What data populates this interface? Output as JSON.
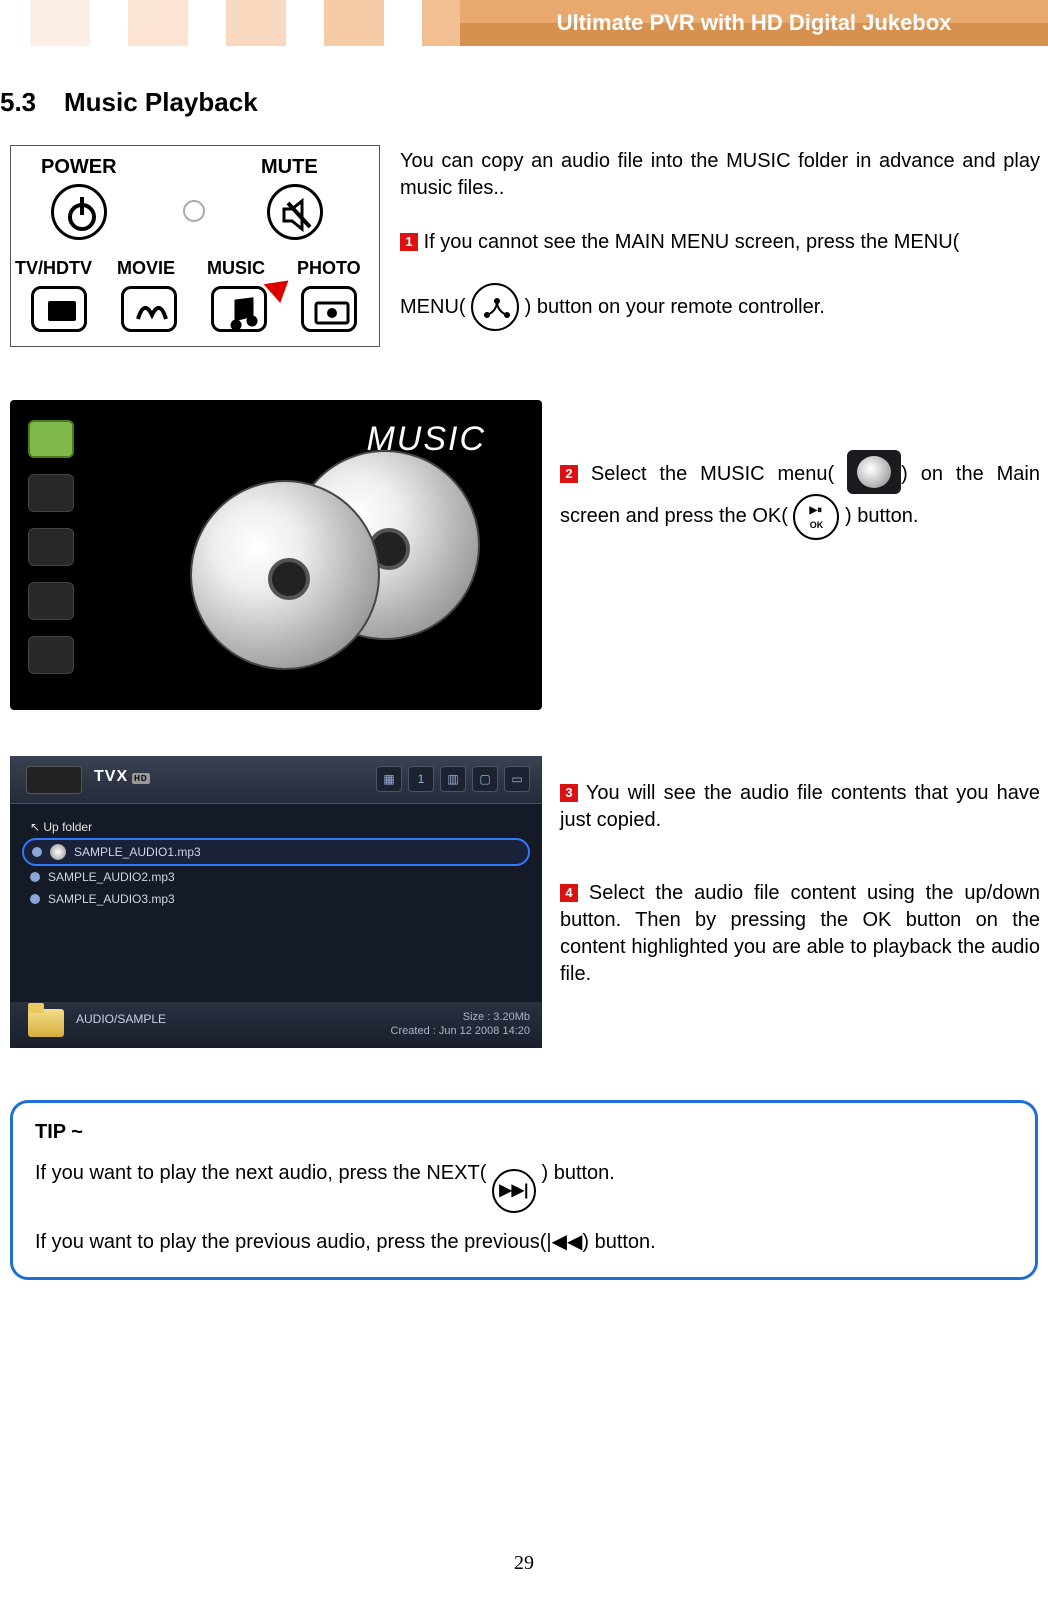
{
  "header": {
    "title": "Ultimate PVR with HD Digital Jukebox"
  },
  "section": {
    "number": "5.3",
    "title": "Music Playback"
  },
  "remote": {
    "labels": {
      "power": "POWER",
      "mute": "MUTE",
      "tv": "TV/HDTV",
      "movie": "MOVIE",
      "music": "MUSIC",
      "photo": "PHOTO"
    }
  },
  "intro": "You can copy an audio file into the MUSIC folder in advance and play music files..",
  "step1": {
    "badge": "1",
    "before": " If you cannot see the MAIN MENU screen, press the MENU(",
    "after": ")    button on your remote controller."
  },
  "music_screen": {
    "title": "MUSIC"
  },
  "step2": {
    "badge": "2",
    "a": " Select the MUSIC menu(",
    "b": ") on the Main screen and press the OK(",
    "c": ")    button.",
    "ok_label": "OK"
  },
  "browser": {
    "logo": "TVX",
    "logo_badge": "HD",
    "icons": [
      "▦",
      "1",
      "▥",
      "▢",
      "▭"
    ],
    "up": "↖  Up folder",
    "files": [
      "SAMPLE_AUDIO1.mp3",
      "SAMPLE_AUDIO2.mp3",
      "SAMPLE_AUDIO3.mp3"
    ],
    "path": "AUDIO/SAMPLE",
    "size": "Size : 3.20Mb",
    "created": "Created : Jun 12 2008   14:20"
  },
  "step3": {
    "badge": "3",
    "text": " You will see the audio file contents that you have just copied."
  },
  "step4": {
    "badge": "4",
    "text": " Select the audio file content using the up/down button. Then by pressing the OK button on the content highlighted you are able to playback the audio file."
  },
  "tip": {
    "heading": "TIP ~",
    "line1a": "If you want to play the next audio, press the NEXT(",
    "line1b": ") button.",
    "next_icon": "▶▶|",
    "line2": "If you want to play the previous audio, press the previous(|◀◀) button."
  },
  "page_number": "29"
}
